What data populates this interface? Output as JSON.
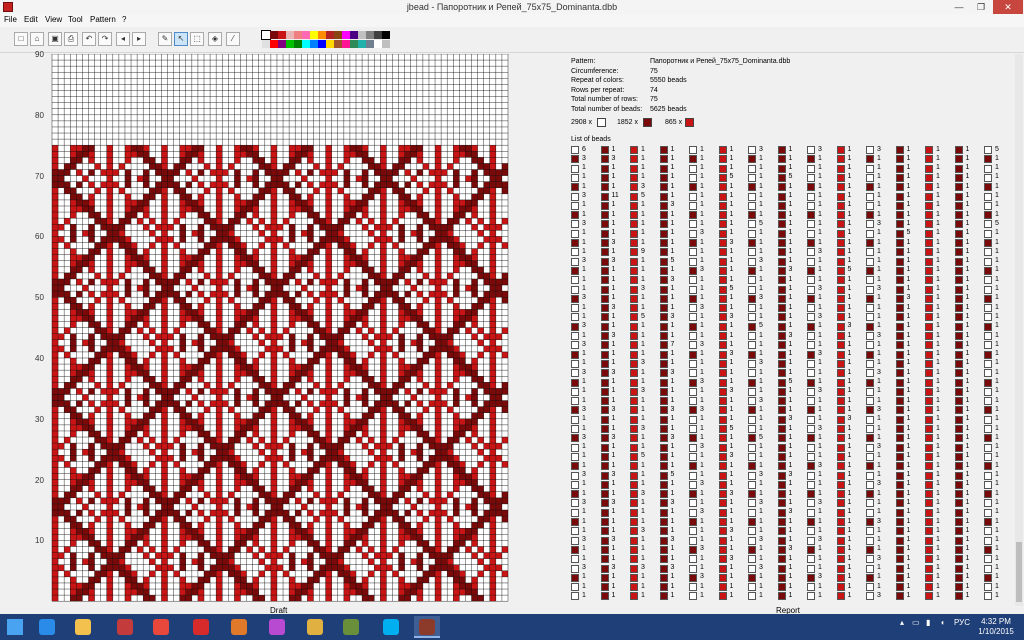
{
  "window": {
    "title": "jbead - Папоротник и Репей_75x75_Dominanta.dbb",
    "minimize_glyph": "—",
    "maximize_glyph": "❐",
    "close_glyph": "✕"
  },
  "menu": [
    "File",
    "Edit",
    "View",
    "Tool",
    "Pattern",
    "?"
  ],
  "toolbar": {
    "buttons": [
      {
        "name": "new-icon",
        "glyph": "□"
      },
      {
        "name": "open-icon",
        "glyph": "⌂"
      },
      {
        "name": "save-icon",
        "glyph": "▣"
      },
      {
        "name": "print-icon",
        "glyph": "⎙"
      },
      {
        "name": "undo-icon",
        "glyph": "↶"
      },
      {
        "name": "redo-icon",
        "glyph": "↷"
      },
      {
        "name": "arrow-up-icon",
        "glyph": "◂"
      },
      {
        "name": "arrow-down-icon",
        "glyph": "▸"
      },
      {
        "name": "pencil-icon",
        "glyph": "✎"
      },
      {
        "name": "pointer-icon",
        "glyph": "↖"
      },
      {
        "name": "select-icon",
        "glyph": "⬚"
      },
      {
        "name": "fill-icon",
        "glyph": "◈"
      },
      {
        "name": "pipette-icon",
        "glyph": "⁄"
      }
    ],
    "palette_row1": [
      "#ffffff",
      "#7a0a0a",
      "#c81414",
      "#e8b4b4",
      "#f08080",
      "#ff69b4",
      "#ffff00",
      "#ff8c00",
      "#b22222",
      "#8b4513",
      "#ff00ff",
      "#4b0082",
      "#c0c0c0",
      "#808080",
      "#404040",
      "#000000"
    ],
    "palette_row2": [
      "#e0e0e0",
      "#ff0000",
      "#800080",
      "#00c000",
      "#008000",
      "#00ffff",
      "#0080ff",
      "#0000ff",
      "#ffd700",
      "#a0522d",
      "#ff1493",
      "#2e8b57",
      "#20b2aa",
      "#708090",
      "#ffffff",
      "#c0c0c0"
    ]
  },
  "colors": {
    "white": "#ffffff",
    "dark_red": "#7a0a0a",
    "red": "#c81414",
    "grid_line": "#000000",
    "taskbar": "#1e3f77"
  },
  "draft": {
    "label": "Draft",
    "row_numbers": [
      "90",
      "80",
      "70",
      "60",
      "50",
      "40",
      "30",
      "20",
      "10"
    ]
  },
  "report": {
    "label": "Report",
    "info": [
      {
        "label": "Pattern:",
        "value": "Папоротник и Репей_75x75_Dominanta.dbb"
      },
      {
        "label": "Circumference:",
        "value": "75"
      },
      {
        "label": "Repeat of colors:",
        "value": "5550 beads"
      },
      {
        "label": "Rows per repeat:",
        "value": "74"
      },
      {
        "label": "Total number of rows:",
        "value": "75"
      },
      {
        "label": "Total number of beads:",
        "value": "5625 beads"
      }
    ],
    "color_counts": [
      {
        "count": "2908 x",
        "color": "#ffffff"
      },
      {
        "count": "1852 x",
        "color": "#7a0a0a"
      },
      {
        "count": "865 x",
        "color": "#c81414"
      }
    ],
    "list_header": "List of beads",
    "list_columns": [
      {
        "color": "#ffffff",
        "counts": [
          "6",
          "3",
          "1",
          "1",
          "1",
          "3",
          "1",
          "1",
          "3",
          "1",
          "1",
          "1",
          "3",
          "1",
          "1",
          "1",
          "3",
          "1",
          "1",
          "3",
          "1",
          "3",
          "1",
          "1",
          "3",
          "1",
          "1",
          "1",
          "3",
          "1",
          "1",
          "3",
          "1",
          "1",
          "1",
          "3",
          "1",
          "1",
          "3",
          "1",
          "1",
          "1",
          "3",
          "1",
          "1",
          "3",
          "1",
          "1",
          "1"
        ]
      },
      {
        "color": "#7a0a0a",
        "counts": [
          "1",
          "3",
          "1",
          "1",
          "1",
          "11",
          "1",
          "1",
          "1",
          "1",
          "3",
          "1",
          "3",
          "1",
          "1",
          "1",
          "1",
          "3",
          "1",
          "1",
          "3",
          "1",
          "1",
          "1",
          "3",
          "1",
          "1",
          "1",
          "3",
          "1",
          "1",
          "3",
          "1",
          "1",
          "1",
          "3",
          "1",
          "1",
          "3",
          "1",
          "1",
          "1",
          "3",
          "1",
          "1",
          "3",
          "1",
          "1",
          "1"
        ]
      },
      {
        "color": "#c81414",
        "counts": [
          "1",
          "1",
          "1",
          "1",
          "3",
          "5",
          "1",
          "1",
          "1",
          "1",
          "1",
          "9",
          "1",
          "1",
          "1",
          "3",
          "1",
          "1",
          "5",
          "1",
          "1",
          "1",
          "1",
          "3",
          "1",
          "1",
          "3",
          "1",
          "1",
          "1",
          "3",
          "1",
          "1",
          "5",
          "1",
          "1",
          "1",
          "3",
          "1",
          "1",
          "1",
          "3",
          "1",
          "1",
          "1",
          "3",
          "1",
          "1",
          "1"
        ]
      },
      {
        "color": "#7a0a0a",
        "counts": [
          "1",
          "1",
          "1",
          "1",
          "1",
          "1",
          "3",
          "1",
          "1",
          "1",
          "1",
          "1",
          "5",
          "1",
          "3",
          "1",
          "1",
          "1",
          "3",
          "1",
          "1",
          "7",
          "1",
          "1",
          "3",
          "1",
          "1",
          "1",
          "3",
          "1",
          "1",
          "3",
          "1",
          "1",
          "1",
          "5",
          "1",
          "1",
          "3",
          "1",
          "1",
          "1",
          "3",
          "1",
          "1",
          "3",
          "1",
          "1",
          "1"
        ]
      },
      {
        "color": "#ffffff",
        "counts": [
          "1",
          "1",
          "1",
          "1",
          "1",
          "1",
          "1",
          "1",
          "1",
          "3",
          "1",
          "1",
          "1",
          "3",
          "1",
          "1",
          "1",
          "3",
          "1",
          "1",
          "1",
          "3",
          "1",
          "1",
          "1",
          "3",
          "1",
          "1",
          "3",
          "1",
          "1",
          "1",
          "3",
          "1",
          "1",
          "1",
          "3",
          "1",
          "1",
          "3",
          "1",
          "1",
          "1",
          "3",
          "1",
          "1",
          "3",
          "1",
          "1"
        ]
      },
      {
        "color": "#c81414",
        "counts": [
          "1",
          "1",
          "1",
          "5",
          "1",
          "1",
          "1",
          "1",
          "1",
          "1",
          "3",
          "1",
          "1",
          "1",
          "1",
          "5",
          "1",
          "1",
          "3",
          "1",
          "1",
          "1",
          "3",
          "1",
          "1",
          "1",
          "3",
          "1",
          "1",
          "1",
          "5",
          "1",
          "1",
          "3",
          "1",
          "1",
          "1",
          "3",
          "1",
          "1",
          "1",
          "3",
          "1",
          "1",
          "3",
          "1",
          "1",
          "1",
          "1"
        ]
      },
      {
        "color": "#ffffff",
        "counts": [
          "3",
          "1",
          "1",
          "1",
          "1",
          "1",
          "1",
          "1",
          "5",
          "1",
          "1",
          "1",
          "3",
          "1",
          "1",
          "1",
          "3",
          "1",
          "1",
          "5",
          "1",
          "1",
          "1",
          "3",
          "1",
          "1",
          "1",
          "3",
          "1",
          "1",
          "1",
          "5",
          "1",
          "1",
          "1",
          "3",
          "1",
          "1",
          "3",
          "1",
          "1",
          "1",
          "3",
          "1",
          "1",
          "3",
          "1",
          "1",
          "1"
        ]
      },
      {
        "color": "#7a0a0a",
        "counts": [
          "1",
          "1",
          "1",
          "5",
          "1",
          "1",
          "1",
          "1",
          "1",
          "1",
          "1",
          "1",
          "1",
          "3",
          "1",
          "1",
          "1",
          "1",
          "1",
          "1",
          "3",
          "1",
          "1",
          "1",
          "1",
          "5",
          "1",
          "1",
          "1",
          "3",
          "1",
          "1",
          "1",
          "1",
          "1",
          "3",
          "1",
          "1",
          "1",
          "3",
          "1",
          "1",
          "1",
          "3",
          "1",
          "1",
          "1",
          "1",
          "1"
        ]
      },
      {
        "color": "#ffffff",
        "counts": [
          "3",
          "1",
          "1",
          "1",
          "1",
          "1",
          "1",
          "1",
          "1",
          "1",
          "1",
          "3",
          "1",
          "1",
          "1",
          "3",
          "1",
          "1",
          "3",
          "1",
          "1",
          "1",
          "3",
          "1",
          "1",
          "1",
          "3",
          "1",
          "1",
          "1",
          "3",
          "1",
          "1",
          "1",
          "3",
          "1",
          "1",
          "1",
          "3",
          "1",
          "1",
          "1",
          "3",
          "1",
          "1",
          "1",
          "3",
          "1",
          "1"
        ]
      },
      {
        "color": "#c81414",
        "counts": [
          "1",
          "1",
          "1",
          "1",
          "1",
          "1",
          "1",
          "1",
          "1",
          "1",
          "1",
          "1",
          "1",
          "5",
          "1",
          "1",
          "1",
          "1",
          "1",
          "3",
          "1",
          "1",
          "1",
          "1",
          "1",
          "1",
          "1",
          "1",
          "1",
          "3",
          "1",
          "1",
          "1",
          "1",
          "1",
          "1",
          "1",
          "1",
          "1",
          "1",
          "1",
          "1",
          "1",
          "1",
          "1",
          "1",
          "1",
          "1",
          "1"
        ]
      },
      {
        "color": "#ffffff",
        "counts": [
          "3",
          "1",
          "1",
          "1",
          "1",
          "1",
          "1",
          "1",
          "3",
          "1",
          "1",
          "1",
          "1",
          "1",
          "1",
          "3",
          "1",
          "1",
          "1",
          "1",
          "3",
          "1",
          "1",
          "1",
          "3",
          "1",
          "1",
          "1",
          "3",
          "1",
          "1",
          "1",
          "3",
          "1",
          "1",
          "1",
          "3",
          "1",
          "1",
          "1",
          "3",
          "1",
          "1",
          "1",
          "3",
          "1",
          "1",
          "1",
          "3"
        ]
      },
      {
        "color": "#7a0a0a",
        "counts": [
          "1",
          "1",
          "1",
          "1",
          "1",
          "1",
          "1",
          "1",
          "1",
          "5",
          "1",
          "1",
          "1",
          "1",
          "1",
          "1",
          "3",
          "1",
          "1",
          "1",
          "1",
          "1",
          "1",
          "1",
          "1",
          "1",
          "1",
          "1",
          "1",
          "1",
          "1",
          "1",
          "1",
          "1",
          "1",
          "1",
          "1",
          "1",
          "1",
          "1",
          "1",
          "1",
          "1",
          "1",
          "1",
          "1",
          "1",
          "1",
          "1"
        ]
      },
      {
        "color": "#c81414",
        "counts": [
          "1",
          "1",
          "1",
          "1",
          "1",
          "1",
          "1",
          "1",
          "1",
          "1",
          "1",
          "1",
          "1",
          "1",
          "1",
          "1",
          "1",
          "1",
          "1",
          "1",
          "1",
          "1",
          "1",
          "1",
          "1",
          "1",
          "1",
          "1",
          "1",
          "1",
          "1",
          "1",
          "1",
          "1",
          "1",
          "1",
          "1",
          "1",
          "1",
          "1",
          "1",
          "1",
          "1",
          "1",
          "1",
          "1",
          "1",
          "1",
          "1"
        ]
      },
      {
        "color": "#7a0a0a",
        "counts": [
          "1",
          "1",
          "1",
          "1",
          "1",
          "1",
          "1",
          "1",
          "1",
          "1",
          "1",
          "1",
          "1",
          "1",
          "1",
          "1",
          "1",
          "1",
          "1",
          "1",
          "1",
          "1",
          "1",
          "1",
          "1",
          "1",
          "1",
          "1",
          "1",
          "1",
          "1",
          "1",
          "1",
          "1",
          "1",
          "1",
          "1",
          "1",
          "1",
          "1",
          "1",
          "1",
          "1",
          "1",
          "1",
          "1",
          "1",
          "1",
          "1"
        ]
      },
      {
        "color": "#ffffff",
        "counts": [
          "5",
          "1",
          "1",
          "1",
          "1",
          "1",
          "1",
          "1",
          "5",
          "1",
          "1",
          "1",
          "1",
          "1",
          "1",
          "1",
          "1",
          "1",
          "1",
          "1",
          "1",
          "1",
          "1",
          "1",
          "1",
          "1",
          "1",
          "1",
          "1",
          "1",
          "1",
          "1",
          "1",
          "1",
          "1",
          "1",
          "1",
          "1",
          "1",
          "1",
          "1",
          "1",
          "1",
          "1",
          "1",
          "1",
          "1",
          "1",
          "1"
        ]
      }
    ]
  },
  "taskbar": {
    "apps": [
      {
        "name": "start-icon",
        "color": "#4aa3f0",
        "active": false
      },
      {
        "name": "internet-explorer-icon",
        "color": "#2a8ce8",
        "active": false
      },
      {
        "name": "file-explorer-icon",
        "color": "#f2c14e",
        "active": false
      },
      {
        "name": "power-app-icon",
        "color": "#c43b3b",
        "active": false
      },
      {
        "name": "yandex-browser-icon",
        "color": "#e8473b",
        "active": false
      },
      {
        "name": "opera-icon",
        "color": "#d72a2a",
        "active": false
      },
      {
        "name": "eye-app-icon",
        "color": "#e07a2a",
        "active": false
      },
      {
        "name": "pen-app-icon",
        "color": "#b74ad1",
        "active": false
      },
      {
        "name": "avatar-app-icon",
        "color": "#e0b040",
        "active": false
      },
      {
        "name": "wand-app-icon",
        "color": "#6a8f3a",
        "active": false
      },
      {
        "name": "skype-icon",
        "color": "#00aff0",
        "active": false
      },
      {
        "name": "jbead-icon",
        "color": "#8c3a2a",
        "active": true
      }
    ],
    "tray": {
      "language": "РУС",
      "time": "4:32 PM",
      "date": "1/10/2015"
    }
  }
}
